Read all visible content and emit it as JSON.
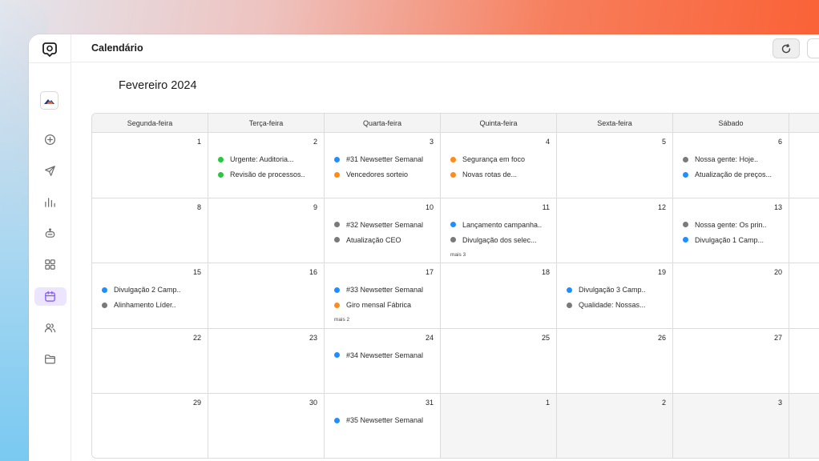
{
  "app": {
    "title": "Calendário"
  },
  "colors": {
    "green": "#27c840",
    "blue": "#1f8fff",
    "orange": "#ff8c1a",
    "gray": "#7a7a7a"
  },
  "icons": {
    "logo": "logo-icon",
    "rail": [
      "plus-circle-icon",
      "send-icon",
      "bar-chart-icon",
      "bot-icon",
      "grid-icon",
      "calendar-icon",
      "users-icon",
      "folder-icon"
    ],
    "refresh": "refresh-icon"
  },
  "calendar": {
    "month_label": "Fevereiro 2024",
    "weekdays": [
      "Segunda-feira",
      "Terça-feira",
      "Quarta-feira",
      "Quinta-feira",
      "Sexta-feira",
      "Sábado"
    ],
    "weeks": [
      [
        {
          "day": "1",
          "events": []
        },
        {
          "day": "2",
          "events": [
            {
              "label": "Urgente: Auditoria...",
              "color": "green"
            },
            {
              "label": "Revisão de processos..",
              "color": "green"
            }
          ]
        },
        {
          "day": "3",
          "events": [
            {
              "label": "#31 Newsetter Semanal",
              "color": "blue"
            },
            {
              "label": "Vencedores sorteio",
              "color": "orange"
            }
          ]
        },
        {
          "day": "4",
          "events": [
            {
              "label": "Segurança em foco",
              "color": "orange"
            },
            {
              "label": "Novas rotas de...",
              "color": "orange"
            }
          ]
        },
        {
          "day": "5",
          "events": []
        },
        {
          "day": "6",
          "events": [
            {
              "label": "Nossa gente: Hoje..",
              "color": "gray"
            },
            {
              "label": "Atualização de preços...",
              "color": "blue"
            }
          ]
        }
      ],
      [
        {
          "day": "8",
          "events": []
        },
        {
          "day": "9",
          "events": []
        },
        {
          "day": "10",
          "events": [
            {
              "label": "#32 Newsetter Semanal",
              "color": "gray"
            },
            {
              "label": "Atualização CEO",
              "color": "gray"
            }
          ]
        },
        {
          "day": "11",
          "events": [
            {
              "label": "Lançamento campanha..",
              "color": "blue"
            },
            {
              "label": "Divulgação dos selec...",
              "color": "gray"
            }
          ],
          "more": "mais 3"
        },
        {
          "day": "12",
          "events": []
        },
        {
          "day": "13",
          "events": [
            {
              "label": "Nossa gente: Os prin..",
              "color": "gray"
            },
            {
              "label": "Divulgação 1 Camp...",
              "color": "blue"
            }
          ]
        }
      ],
      [
        {
          "day": "15",
          "events": [
            {
              "label": "Divulgação 2 Camp..",
              "color": "blue"
            },
            {
              "label": "Alinhamento Líder..",
              "color": "gray"
            }
          ]
        },
        {
          "day": "16",
          "events": []
        },
        {
          "day": "17",
          "events": [
            {
              "label": "#33 Newsetter Semanal",
              "color": "blue"
            },
            {
              "label": "Giro mensal Fábrica",
              "color": "orange"
            }
          ],
          "more": "mais 2"
        },
        {
          "day": "18",
          "events": []
        },
        {
          "day": "19",
          "events": [
            {
              "label": "Divulgação 3 Camp..",
              "color": "blue"
            },
            {
              "label": "Qualidade: Nossas...",
              "color": "gray"
            }
          ]
        },
        {
          "day": "20",
          "events": []
        }
      ],
      [
        {
          "day": "22",
          "events": []
        },
        {
          "day": "23",
          "events": []
        },
        {
          "day": "24",
          "events": [
            {
              "label": "#34 Newsetter Semanal",
              "color": "blue"
            }
          ]
        },
        {
          "day": "25",
          "events": []
        },
        {
          "day": "26",
          "events": []
        },
        {
          "day": "27",
          "events": []
        }
      ],
      [
        {
          "day": "29",
          "events": []
        },
        {
          "day": "30",
          "events": []
        },
        {
          "day": "31",
          "events": [
            {
              "label": "#35 Newsetter Semanal",
              "color": "blue"
            }
          ]
        },
        {
          "day": "1",
          "out": true,
          "events": []
        },
        {
          "day": "2",
          "out": true,
          "events": []
        },
        {
          "day": "3",
          "out": true,
          "events": []
        }
      ]
    ]
  }
}
